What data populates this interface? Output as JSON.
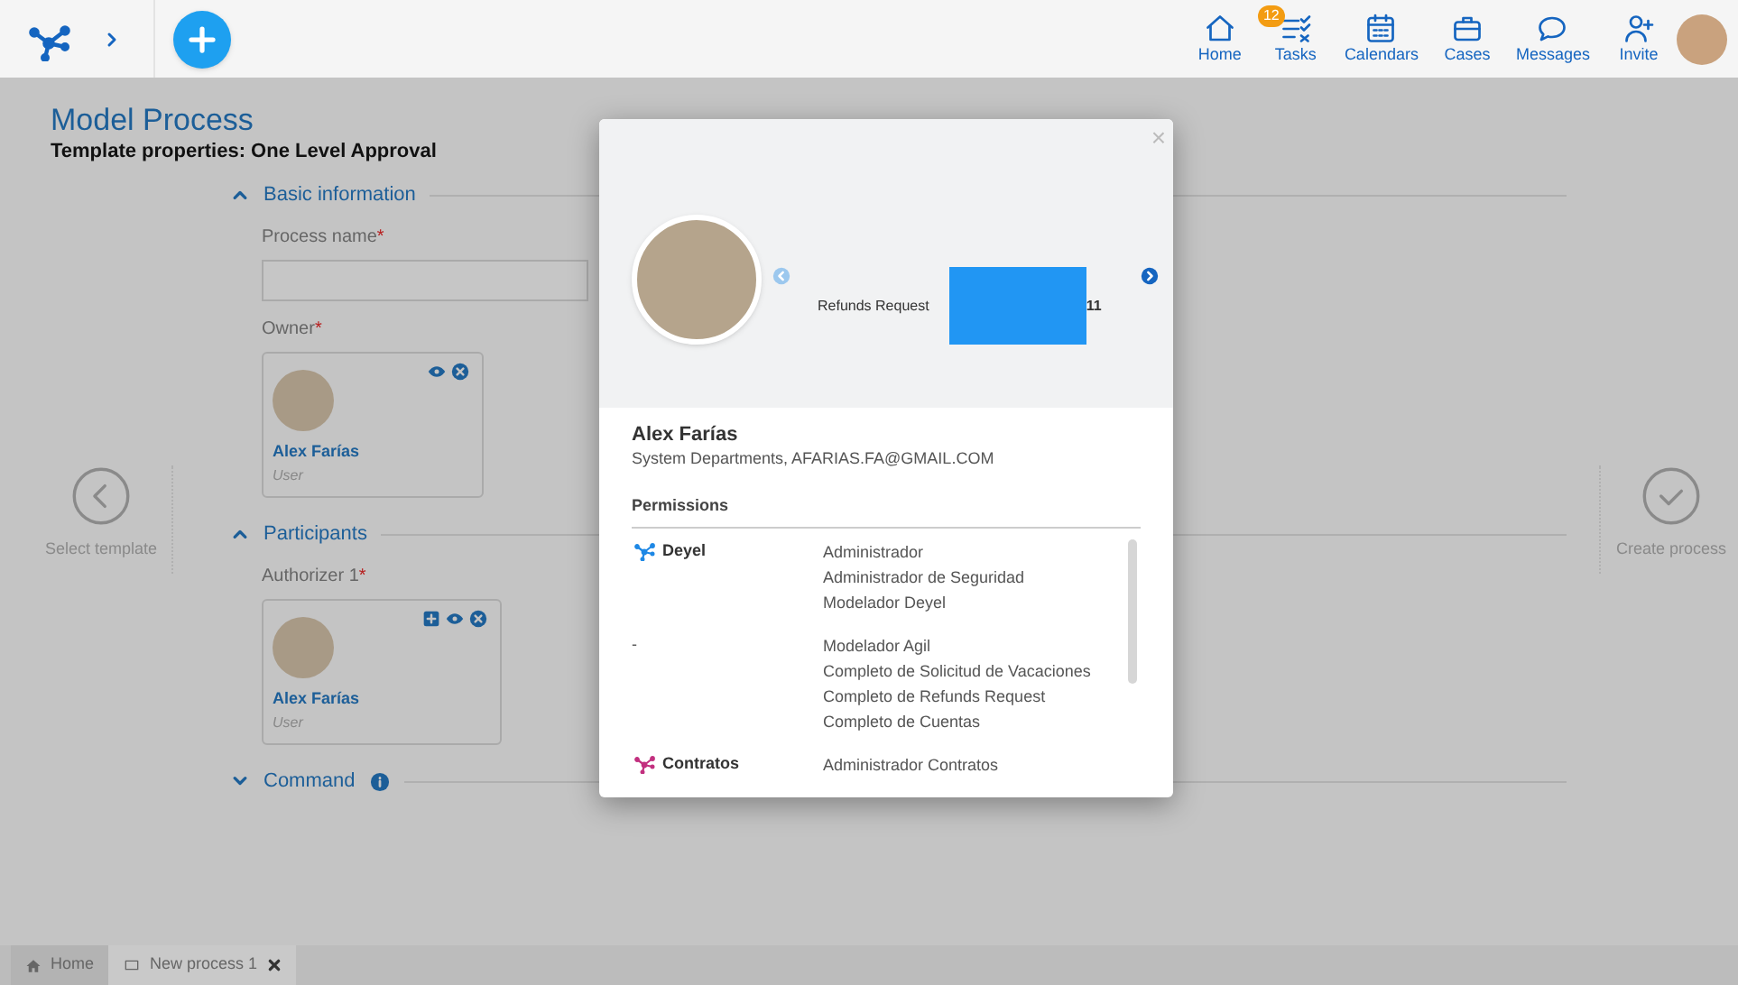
{
  "header": {
    "nav": [
      {
        "label": "Home",
        "kind": "home"
      },
      {
        "label": "Tasks",
        "kind": "tasks",
        "badge": "12"
      },
      {
        "label": "Calendars",
        "kind": "calendar"
      },
      {
        "label": "Cases",
        "kind": "cases"
      },
      {
        "label": "Messages",
        "kind": "messages"
      },
      {
        "label": "Invite",
        "kind": "invite"
      }
    ]
  },
  "page": {
    "title": "Model Process",
    "subtitle": "Template properties: One Level Approval",
    "sections": [
      {
        "title": "Basic information",
        "expanded": true,
        "fields": [
          {
            "kind": "text",
            "label": "Process name",
            "required_mark": "*"
          },
          {
            "kind": "user",
            "label": "Owner",
            "required_mark": "*",
            "name": "Alex Farías",
            "role": "User",
            "addable": false,
            "viewable": true,
            "removable": true
          }
        ]
      },
      {
        "title": "Participants",
        "expanded": true,
        "fields": [
          {
            "kind": "user",
            "label": "Authorizer 1",
            "required_mark": "*",
            "name": "Alex Farías",
            "role": "User",
            "addable": true,
            "viewable": true,
            "removable": true
          }
        ]
      },
      {
        "title": "Command",
        "expanded": false,
        "info": true
      }
    ]
  },
  "wizard": {
    "previous": "Select template",
    "next": "Create process"
  },
  "modal": {
    "close": "×",
    "carousel": {
      "label": "Refunds Request",
      "count": "11"
    },
    "user": {
      "name": "Alex Farías",
      "details": "System Departments, AFARIAS.FA@GMAIL.COM"
    },
    "permissions": {
      "title": "Permissions",
      "groups": [
        {
          "app": "Deyel",
          "color": "#1e88e5",
          "roles": [
            "Administrador",
            "Administrador de Seguridad",
            "Modelador Deyel"
          ]
        },
        {
          "app": "-",
          "roles": [
            "Modelador Agil",
            "Completo de Solicitud de Vacaciones",
            "Completo de Refunds Request",
            "Completo de Cuentas"
          ]
        },
        {
          "app": "Contratos",
          "color": "#c2307f",
          "roles": [
            "Administrador Contratos"
          ]
        }
      ]
    }
  },
  "tabs": [
    {
      "label": "Home",
      "kind": "home",
      "selected": false
    },
    {
      "label": "New process 1",
      "kind": "doc",
      "selected": true,
      "closable": true
    }
  ]
}
